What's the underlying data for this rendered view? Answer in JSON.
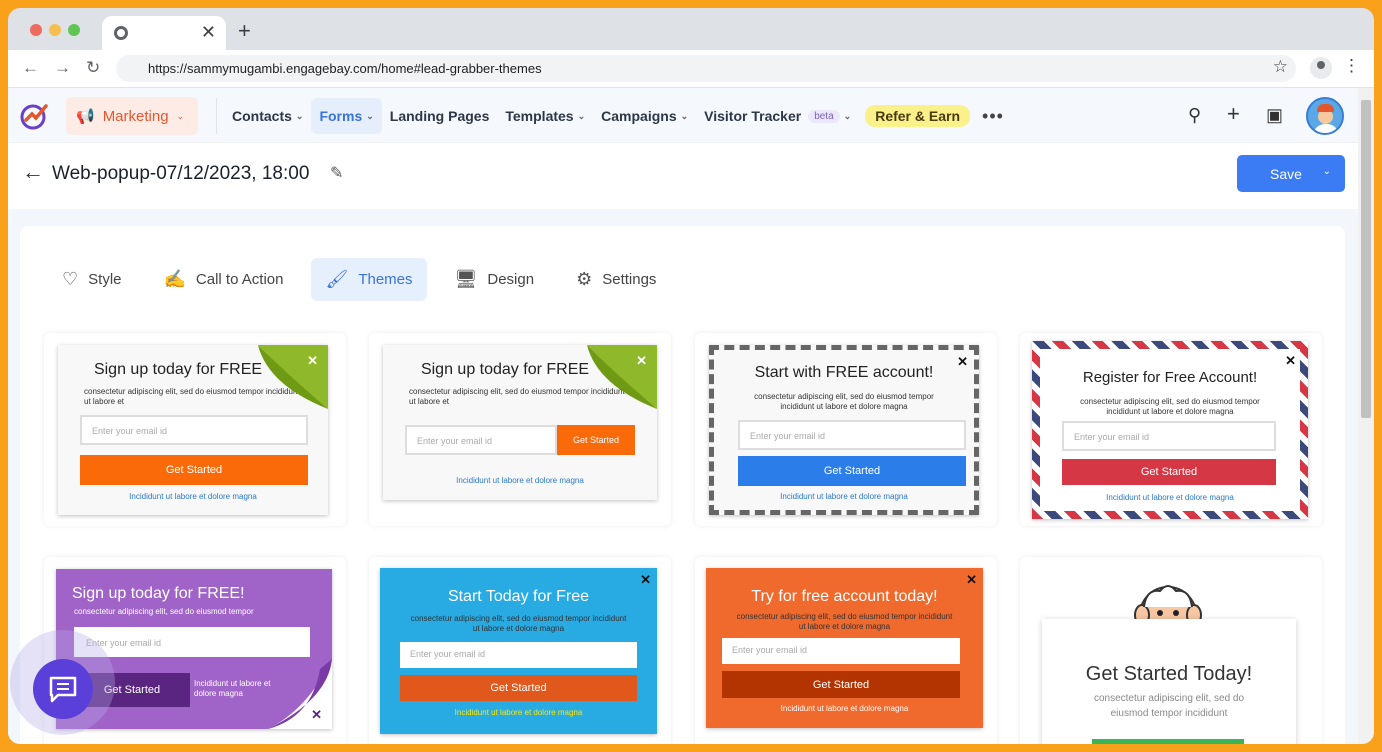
{
  "browser": {
    "tab_close": "✕",
    "new_tab": "+",
    "url": "https://sammymugambi.engagebay.com/home#lead-grabber-themes",
    "colors": {
      "red": "#ed6a5e",
      "yellow": "#f5bf4f",
      "green": "#61c554"
    }
  },
  "topnav": {
    "module": "Marketing",
    "items": [
      {
        "label": "Contacts",
        "chevron": true,
        "active": false
      },
      {
        "label": "Forms",
        "chevron": true,
        "active": true
      },
      {
        "label": "Landing Pages",
        "chevron": false,
        "active": false
      },
      {
        "label": "Templates",
        "chevron": true,
        "active": false
      },
      {
        "label": "Campaigns",
        "chevron": true,
        "active": false
      },
      {
        "label": "Visitor Tracker",
        "chevron": true,
        "active": false
      }
    ],
    "beta": "beta",
    "refer": "Refer & Earn",
    "more": "•••"
  },
  "page": {
    "back": "←",
    "title": "Web-popup-07/12/2023, 18:00",
    "save": "Save"
  },
  "tabs": [
    {
      "label": "Style",
      "icon": "heart-icon",
      "active": false
    },
    {
      "label": "Call to Action",
      "icon": "form-edit-icon",
      "active": false
    },
    {
      "label": "Themes",
      "icon": "brush-icon",
      "active": true
    },
    {
      "label": "Design",
      "icon": "monitor-icon",
      "active": false
    },
    {
      "label": "Settings",
      "icon": "gear-icon",
      "active": false
    }
  ],
  "themes": {
    "t1": {
      "title": "Sign up today for FREE",
      "sub": "consectetur adipiscing elit, sed do eiusmod tempor incididunt ut labore et",
      "placeholder": "Enter your email id",
      "button": "Get Started",
      "link": "Incididunt ut labore et dolore magna",
      "close": "✕"
    },
    "t2": {
      "title": "Sign up today for FREE",
      "sub": "consectetur adipiscing elit, sed do eiusmod tempor incididunt ut labore et",
      "placeholder": "Enter your email id",
      "button": "Get Started",
      "link": "Incididunt ut labore et dolore magna",
      "close": "✕"
    },
    "t3": {
      "title": "Start with FREE account!",
      "sub": "consectetur adipiscing elit, sed do eiusmod tempor incididunt ut labore et dolore magna",
      "placeholder": "Enter your email id",
      "button": "Get Started",
      "link": "Incididunt ut labore et dolore magna",
      "close": "✕"
    },
    "t4": {
      "title": "Register for Free Account!",
      "sub": "consectetur adipiscing elit, sed do eiusmod tempor incididunt ut labore et dolore magna",
      "placeholder": "Enter your email id",
      "button": "Get Started",
      "link": "Incididunt ut labore et dolore magna",
      "close": "✕"
    },
    "t5": {
      "title": "Sign up today for FREE!",
      "sub": "consectetur adipiscing elit, sed do eiusmod tempor",
      "placeholder": "Enter your email id",
      "button": "Get Started",
      "link": "Incididunt ut labore et dolore magna",
      "close": "✕"
    },
    "t6": {
      "title": "Start Today for Free",
      "sub": "consectetur adipiscing elit, sed do eiusmod tempor incididunt ut labore et dolore magna",
      "placeholder": "Enter your email id",
      "button": "Get Started",
      "link": "Incididunt ut labore et dolore magna",
      "close": "✕"
    },
    "t7": {
      "title": "Try for free account today!",
      "sub": "consectetur adipiscing elit, sed do eiusmod tempor incididunt ut labore et dolore magna",
      "placeholder": "Enter your email id",
      "button": "Get Started",
      "link": "Incididunt ut labore et dolore magna",
      "close": "✕"
    },
    "t8": {
      "title": "Get Started Today!",
      "sub": "consectetur adipiscing elit, sed do eiusmod tempor incididunt"
    }
  },
  "colors": {
    "orange": "#fb6a09",
    "blue": "#2b7de9",
    "red": "#d53844",
    "purple": "#a064c8",
    "sky": "#28aae3",
    "rust": "#f06a2e",
    "green": "#3cb45a",
    "accent": "#3b7cf4"
  }
}
